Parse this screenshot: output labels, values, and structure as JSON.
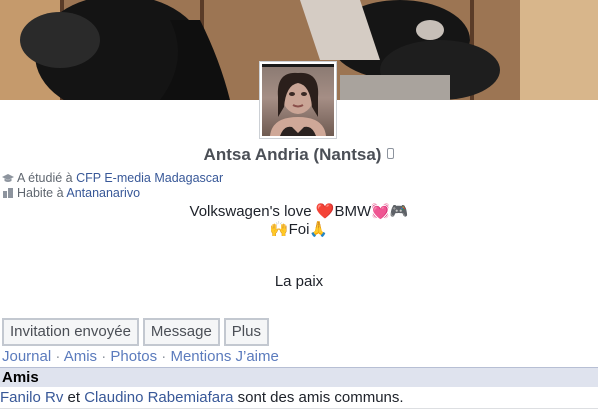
{
  "profile": {
    "name": "Antsa Andria (Nantsa)",
    "studied_prefix": "A étudié à",
    "studied_place": "CFP E-media Madagascar",
    "lives_prefix": "Habite à",
    "lives_place": "Antananarivo"
  },
  "bio": {
    "line1": "Volkswagen's love ❤️BMW💓🎮",
    "line2": "🙌Foi🙏",
    "line3": "La paix"
  },
  "actions": {
    "invite_label": "Invitation envoyée",
    "message_label": "Message",
    "more_label": "Plus"
  },
  "tabs": {
    "journal": "Journal",
    "amis": "Amis",
    "photos": "Photos",
    "mentions": "Mentions J’aime",
    "separator": "·"
  },
  "friends_section": {
    "title": "Amis",
    "friend1": "Fanilo Rv",
    "conjunction": "et",
    "friend2": "Claudino Rabemiafara",
    "suffix": "sont des amis communs."
  },
  "icons": {
    "study": "graduation-cap-icon",
    "home": "home-icon",
    "phone": "mobile-phone-icon"
  },
  "colors": {
    "link": "#385898",
    "section_bg": "#dfe3ee"
  }
}
